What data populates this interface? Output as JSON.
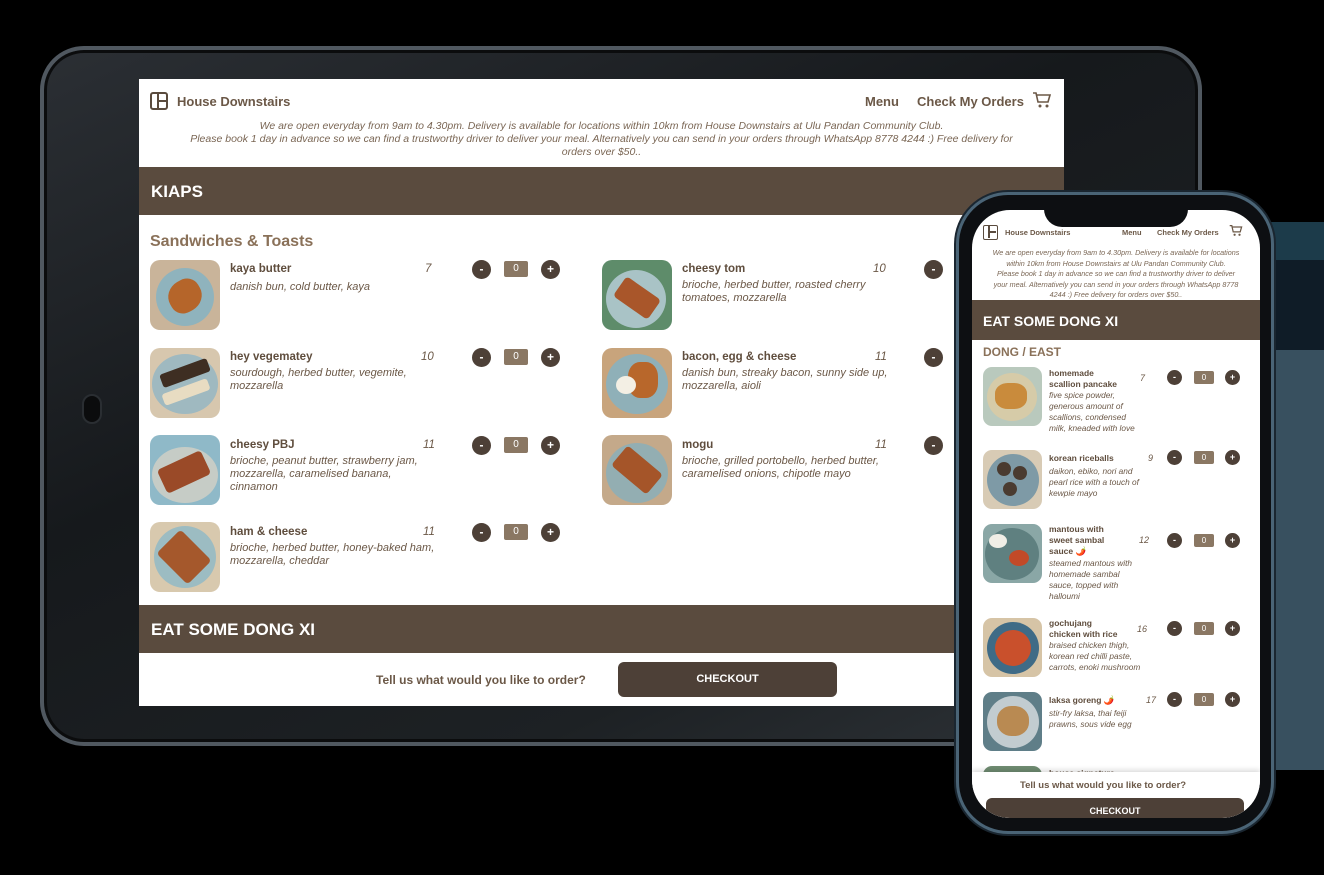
{
  "tablet": {
    "brand": "House Downstairs",
    "nav": {
      "menu": "Menu",
      "orders": "Check My Orders"
    },
    "notice": [
      "We are open everyday from 9am to 4.30pm. Delivery is available for locations within 10km from House Downstairs at Ulu Pandan Community Club.",
      "Please book 1 day in advance so we can find a trustworthy driver to deliver your meal. Alternatively you can send in your orders through WhatsApp 8778 4244 :) Free delivery for",
      "orders over $50.."
    ],
    "category1": "KIAPS",
    "subcategory1": "Sandwiches & Toasts",
    "items": [
      {
        "name": "kaya butter",
        "price": "7",
        "desc": [
          "danish bun, cold butter, kaya"
        ],
        "qty": "0"
      },
      {
        "name": "cheesy tom",
        "price": "10",
        "desc": [
          "brioche, herbed butter, roasted cherry",
          "tomatoes, mozzarella"
        ],
        "qty": ""
      },
      {
        "name": "hey vegematey",
        "price": "10",
        "desc": [
          "sourdough, herbed butter, vegemite,",
          "mozzarella"
        ],
        "qty": "0"
      },
      {
        "name": "bacon, egg & cheese",
        "price": "11",
        "desc": [
          "danish bun, streaky bacon, sunny side up,",
          "mozzarella, aioli"
        ],
        "qty": ""
      },
      {
        "name": "cheesy PBJ",
        "price": "11",
        "desc": [
          "brioche, peanut butter, strawberry jam,",
          "mozzarella, caramelised banana,",
          "cinnamon"
        ],
        "qty": "0"
      },
      {
        "name": "mogu",
        "price": "11",
        "desc": [
          "brioche, grilled portobello, herbed butter,",
          "caramelised onions, chipotle mayo"
        ],
        "qty": ""
      },
      {
        "name": "ham & cheese",
        "price": "11",
        "desc": [
          "brioche, herbed butter, honey-baked ham,",
          "mozzarella, cheddar"
        ],
        "qty": "0"
      }
    ],
    "category2": "EAT SOME DONG XI",
    "cta": "Tell us what would you like to order?",
    "checkout": "CHECKOUT",
    "minus": "-",
    "plus": "+"
  },
  "phone": {
    "brand": "House Downstairs",
    "nav": {
      "menu": "Menu",
      "orders": "Check My Orders"
    },
    "notice": [
      "We are open everyday from 9am to 4.30pm. Delivery is available for locations",
      "within 10km from House Downstairs at Ulu Pandan Community Club.",
      "Please book 1 day in advance so we can find a trustworthy driver to deliver",
      "your meal. Alternatively you can send in your orders through WhatsApp 8778",
      "4244 :) Free delivery for orders over $50.."
    ],
    "category": "EAT SOME DONG XI",
    "subcategory": "DONG / EAST",
    "items": [
      {
        "name": [
          "homemade",
          "scallion pancake"
        ],
        "price": "7",
        "desc": [
          "five spice powder,",
          "generous amount of",
          "scallions, condensed",
          "milk, kneaded with love"
        ],
        "qty": "0"
      },
      {
        "name": [
          "korean riceballs"
        ],
        "price": "9",
        "desc": [
          "daikon, ebiko, nori and",
          "pearl rice with a touch of",
          "kewpie mayo"
        ],
        "qty": "0"
      },
      {
        "name": [
          "mantous with",
          "sweet sambal",
          "sauce 🌶️"
        ],
        "price": "12",
        "desc": [
          "steamed mantous with",
          "homemade sambal",
          "sauce, topped with",
          "halloumi"
        ],
        "qty": "0"
      },
      {
        "name": [
          "gochujang",
          "chicken with rice"
        ],
        "price": "16",
        "desc": [
          "braised chicken thigh,",
          "korean red chilli paste,",
          "carrots, enoki mushroom"
        ],
        "qty": "0"
      },
      {
        "name": [
          "laksa goreng 🌶️"
        ],
        "price": "17",
        "desc": [
          "stir-fry laksa, thai feiji",
          "prawns, sous vide egg"
        ],
        "qty": "0"
      },
      {
        "name": [
          "house signature"
        ],
        "price": "",
        "desc": [],
        "qty": ""
      }
    ],
    "cta": "Tell us what would you like to order?",
    "checkout": "CHECKOUT",
    "minus": "-",
    "plus": "+"
  }
}
